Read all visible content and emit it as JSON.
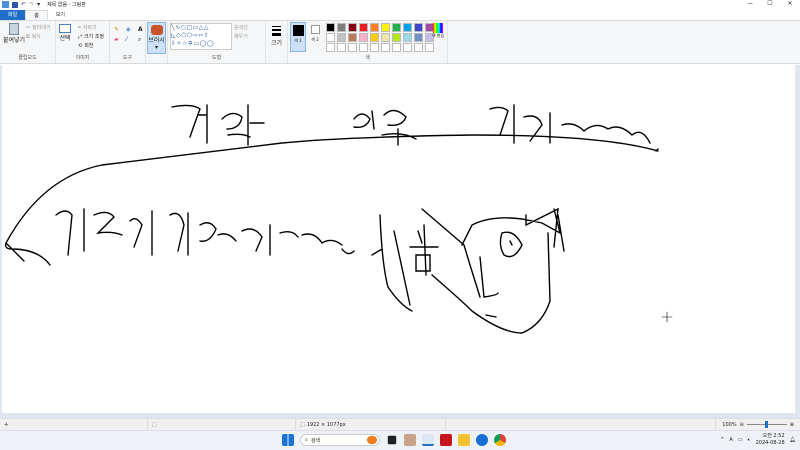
{
  "window": {
    "title": "제목 없음 - 그림판",
    "minimize": "—",
    "maximize": "☐",
    "close": "✕"
  },
  "tabs": [
    {
      "label": "파일"
    },
    {
      "label": "홈"
    },
    {
      "label": "보기"
    }
  ],
  "ribbon": {
    "clipboard": {
      "paste": "붙여넣기",
      "cut": "잘라내기",
      "copy": "복사",
      "label": "클립보드"
    },
    "image": {
      "select": "선택",
      "crop": "자르기",
      "resize": "크기 조정",
      "rotate": "회전",
      "label": "이미지"
    },
    "tools": {
      "label": "도구"
    },
    "brush": {
      "label": "브러시"
    },
    "shapes": {
      "outline": "윤곽선",
      "fill": "채우기",
      "label": "도형"
    },
    "size": {
      "label": "크기"
    },
    "colors": {
      "color1": "색 1",
      "color2": "색 2",
      "edit": "색 편집",
      "label": "색",
      "palette": [
        "#000000",
        "#7f7f7f",
        "#880015",
        "#ed1c24",
        "#ff7f27",
        "#fff200",
        "#22b14c",
        "#00a2e8",
        "#3f48cc",
        "#a349a4",
        "#ffffff",
        "#c3c3c3",
        "#b97a57",
        "#ffaec9",
        "#ffc90e",
        "#efe4b0",
        "#b5e61d",
        "#99d9ea",
        "#7092be",
        "#c8bfe7",
        "#ffffff",
        "#ffffff",
        "#ffffff",
        "#ffffff",
        "#ffffff",
        "#ffffff",
        "#ffffff",
        "#ffffff",
        "#ffffff",
        "#ffffff"
      ]
    }
  },
  "status": {
    "cursor": "✛",
    "selection": "⬚",
    "dimensions": "1922 × 1077px",
    "zoom": "100%"
  },
  "taskbar": {
    "search": "검색",
    "time": "오전 2:52",
    "date": "2024-08-28"
  }
}
